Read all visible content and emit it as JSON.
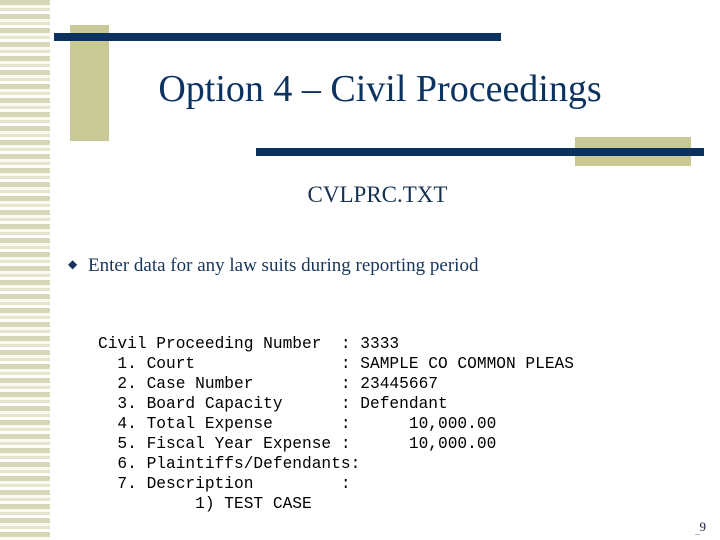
{
  "slide": {
    "title": "Option 4 – Civil Proceedings",
    "subtitle": "CVLPRC.TXT",
    "page_number": "9",
    "page_tick": "␣"
  },
  "bullet": {
    "glyph": "◆",
    "text": "Enter data for any law suits during reporting period"
  },
  "terminal": {
    "lines": [
      "Civil Proceeding Number  : 3333",
      "  1. Court               : SAMPLE CO COMMON PLEAS",
      "  2. Case Number         : 23445667",
      "  3. Board Capacity      : Defendant",
      "  4. Total Expense       :      10,000.00",
      "  5. Fiscal Year Expense :      10,000.00",
      "  6. Plaintiffs/Defendants:",
      "  7. Description         :",
      "          1) TEST CASE"
    ],
    "fields": [
      {
        "index": "",
        "label": "Civil Proceeding Number",
        "separator": ":",
        "value": "3333"
      },
      {
        "index": "1.",
        "label": "Court",
        "separator": ":",
        "value": "SAMPLE CO COMMON PLEAS"
      },
      {
        "index": "2.",
        "label": "Case Number",
        "separator": ":",
        "value": "23445667"
      },
      {
        "index": "3.",
        "label": "Board Capacity",
        "separator": ":",
        "value": "Defendant"
      },
      {
        "index": "4.",
        "label": "Total Expense",
        "separator": ":",
        "value": "10,000.00"
      },
      {
        "index": "5.",
        "label": "Fiscal Year Expense",
        "separator": ":",
        "value": "10,000.00"
      },
      {
        "index": "6.",
        "label": "Plaintiffs/Defendants",
        "separator": ":",
        "value": ""
      },
      {
        "index": "7.",
        "label": "Description",
        "separator": ":",
        "value": ""
      },
      {
        "index": "",
        "label": "1) TEST CASE",
        "separator": "",
        "value": ""
      }
    ]
  },
  "theme": {
    "navy": "#0c3360",
    "title_navy": "#0c3360",
    "body_navy": "#17355a",
    "tan": "#c9c996",
    "stripe_light": "#e6e6cf",
    "stripe_dark": "#d8d8b8",
    "background": "#ffffff",
    "terminal_text": "#000000"
  }
}
